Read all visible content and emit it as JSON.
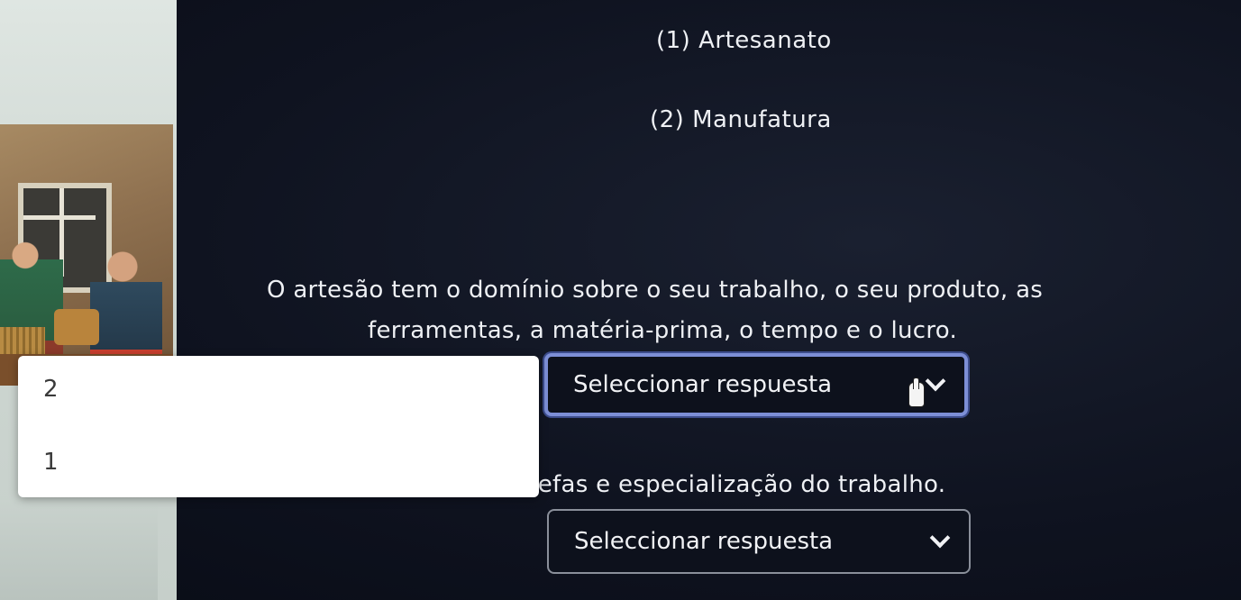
{
  "options": {
    "option_1": "(1) Artesanato",
    "option_2": "(2) Manufatura"
  },
  "questions": [
    {
      "statement_line_1": "O artesão tem o domínio sobre o seu trabalho, o seu produto, as",
      "statement_line_2": "ferramentas, a matéria-prima, o tempo e o lucro.",
      "select_placeholder": "Seleccionar respuesta",
      "focused": true
    },
    {
      "statement": "Divisão de tarefas e especialização do trabalho.",
      "select_placeholder": "Seleccionar respuesta",
      "focused": false
    }
  ],
  "dropdown": {
    "items": [
      "2",
      "1"
    ]
  },
  "icons": {
    "select_arrow": "chevron-down-icon",
    "cursor": "hand-cursor-icon"
  },
  "colors": {
    "background": "#0f1320",
    "focus_border": "#7d8fd6",
    "text": "#eef0f4"
  }
}
